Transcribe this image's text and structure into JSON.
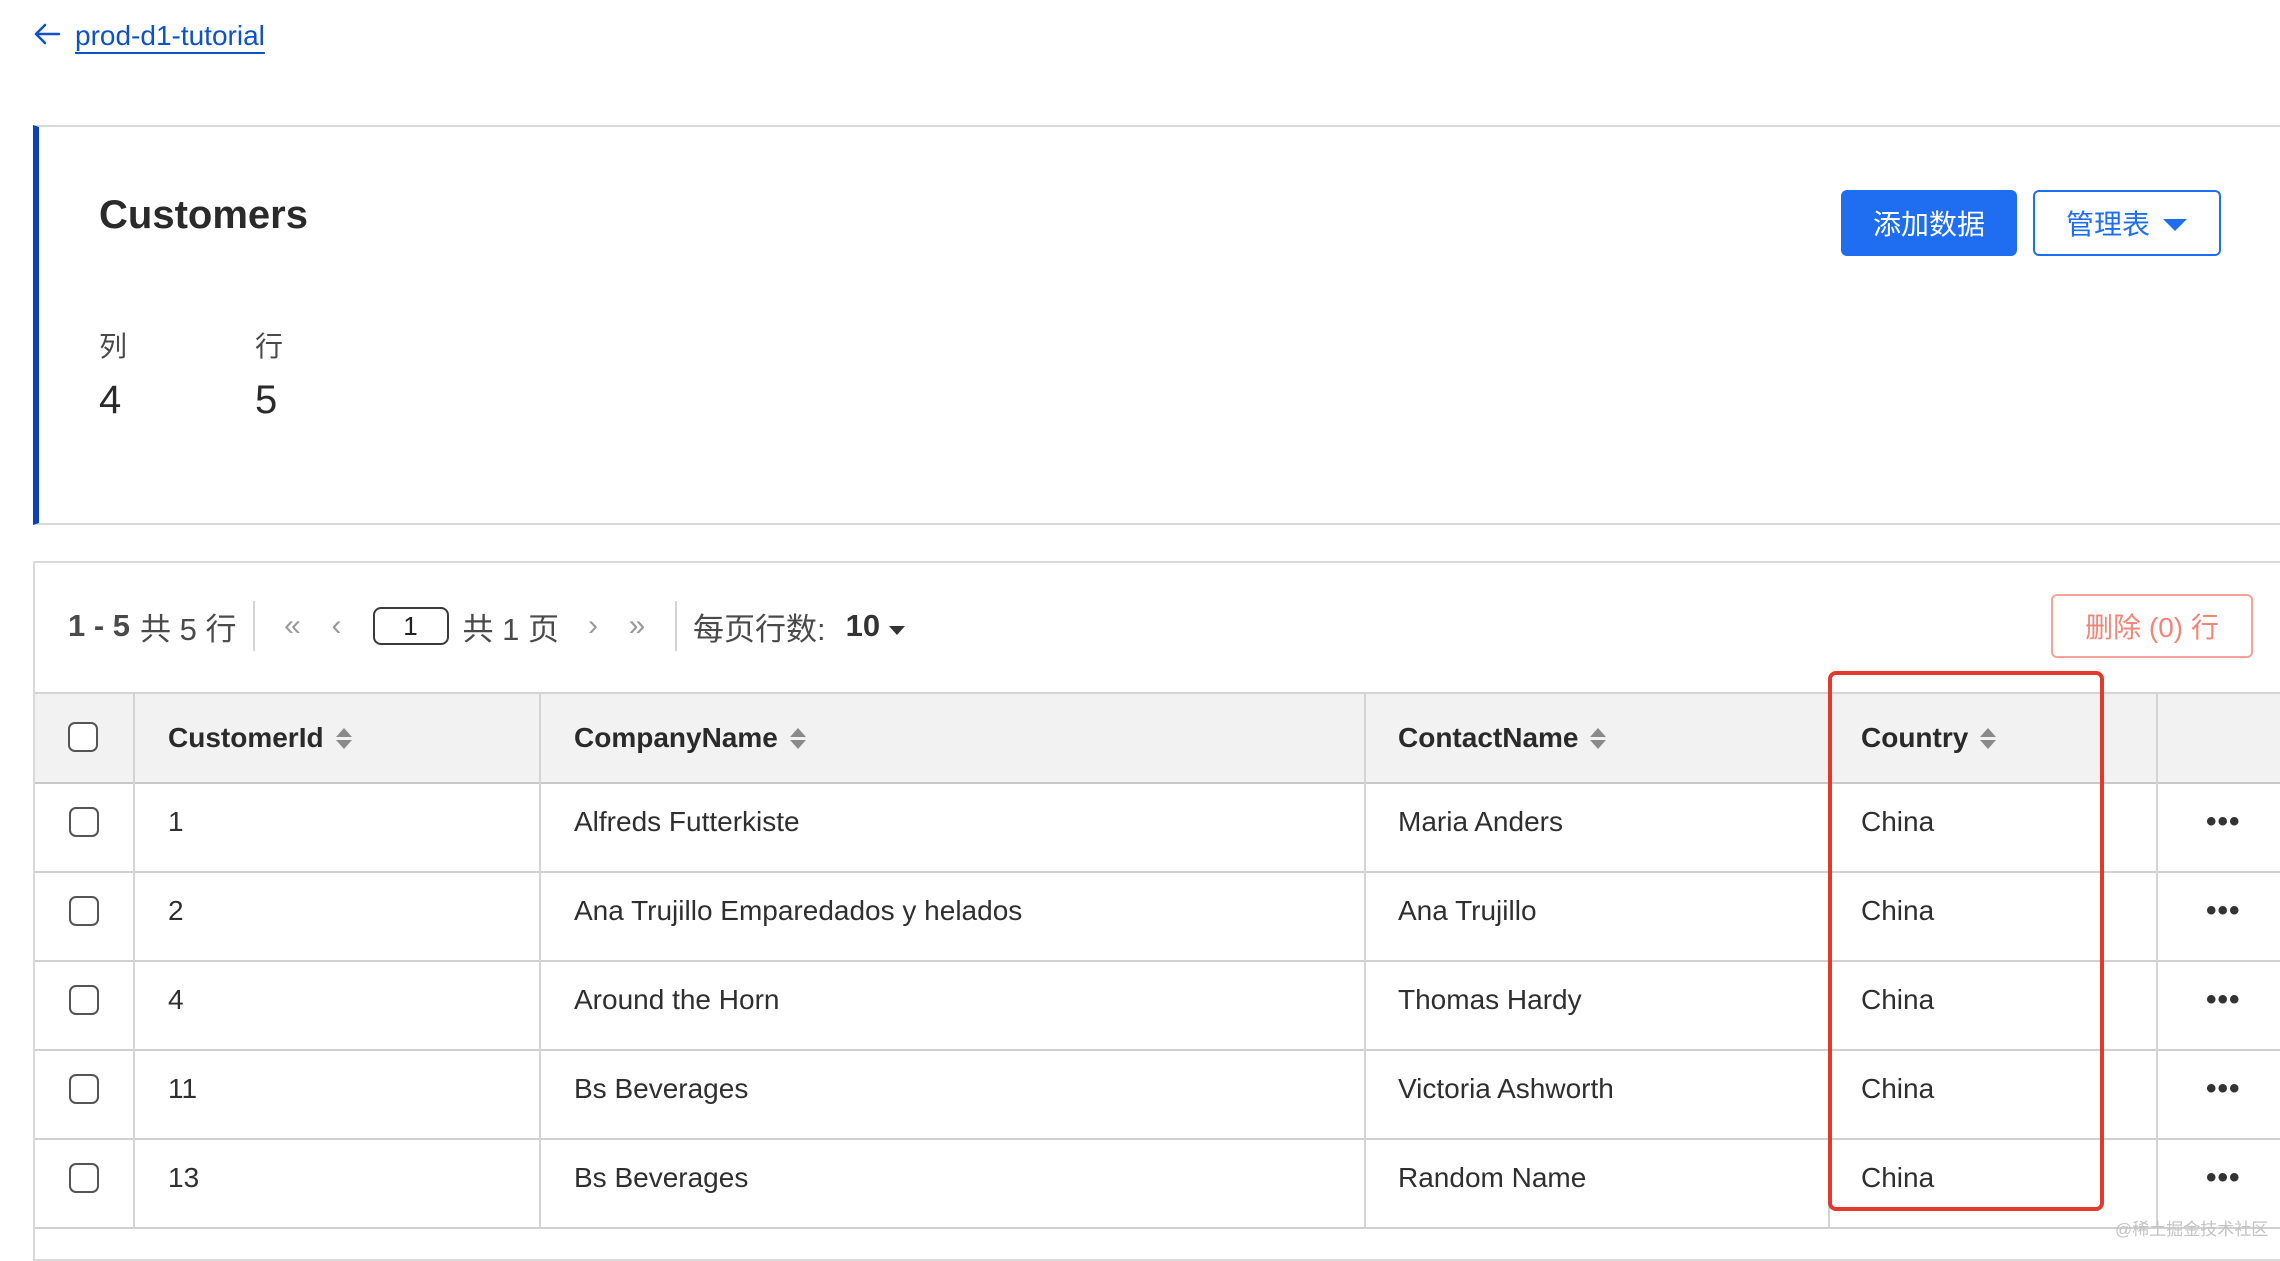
{
  "breadcrumb": {
    "back_label": "prod-d1-tutorial"
  },
  "summary": {
    "title": "Customers",
    "columns_label": "列",
    "columns_value": "4",
    "rows_label": "行",
    "rows_value": "5",
    "add_data_button": "添加数据",
    "manage_table_button": "管理表"
  },
  "pagination": {
    "range": "1 - 5",
    "total_rows": "共 5 行",
    "current_page": "1",
    "total_pages": "共 1 页",
    "rows_per_page_label": "每页行数:",
    "rows_per_page_value": "10",
    "delete_button": "删除 (0) 行"
  },
  "table": {
    "columns": [
      "CustomerId",
      "CompanyName",
      "ContactName",
      "Country"
    ],
    "rows": [
      [
        "1",
        "Alfreds Futterkiste",
        "Maria Anders",
        "China"
      ],
      [
        "2",
        "Ana Trujillo Emparedados y helados",
        "Ana Trujillo",
        "China"
      ],
      [
        "4",
        "Around the Horn",
        "Thomas Hardy",
        "China"
      ],
      [
        "11",
        "Bs Beverages",
        "Victoria Ashworth",
        "China"
      ],
      [
        "13",
        "Bs Beverages",
        "Random Name",
        "China"
      ]
    ]
  },
  "watermark": "@稀土掘金技术社区",
  "colors": {
    "primary": "#1f6df0",
    "accent_bar": "#0d44b5",
    "danger": "#f0857a",
    "highlight": "#e13a2c"
  }
}
